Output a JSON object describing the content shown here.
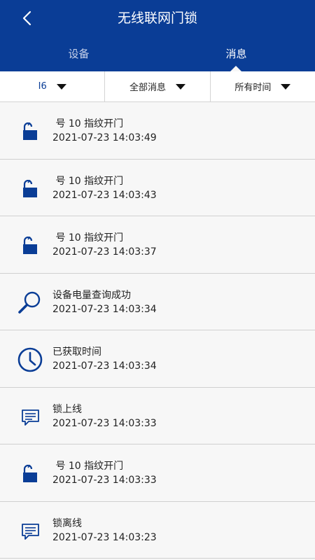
{
  "header": {
    "title": "无线联网门锁",
    "tabs": [
      {
        "label": "设备",
        "active": false
      },
      {
        "label": "消息",
        "active": true
      }
    ]
  },
  "filters": {
    "device": "I6",
    "type": "全部消息",
    "time": "所有时间"
  },
  "messages": [
    {
      "icon": "unlock-icon",
      "text": " 号 10 指纹开门",
      "time": "2021-07-23 14:03:49"
    },
    {
      "icon": "unlock-icon",
      "text": " 号 10 指纹开门",
      "time": "2021-07-23 14:03:43"
    },
    {
      "icon": "unlock-icon",
      "text": " 号 10 指纹开门",
      "time": "2021-07-23 14:03:37"
    },
    {
      "icon": "magnifier-icon",
      "text": "设备电量查询成功",
      "time": "2021-07-23 14:03:34"
    },
    {
      "icon": "clock-icon",
      "text": "已获取时间",
      "time": "2021-07-23 14:03:34"
    },
    {
      "icon": "chat-icon",
      "text": "锁上线",
      "time": "2021-07-23 14:03:33"
    },
    {
      "icon": "unlock-icon",
      "text": " 号 10 指纹开门",
      "time": "2021-07-23 14:03:33"
    },
    {
      "icon": "chat-icon",
      "text": "锁离线",
      "time": "2021-07-23 14:03:23"
    }
  ],
  "colors": {
    "primary": "#0a3d96",
    "background": "#f7f7f7",
    "divider": "#d0d0d0"
  }
}
